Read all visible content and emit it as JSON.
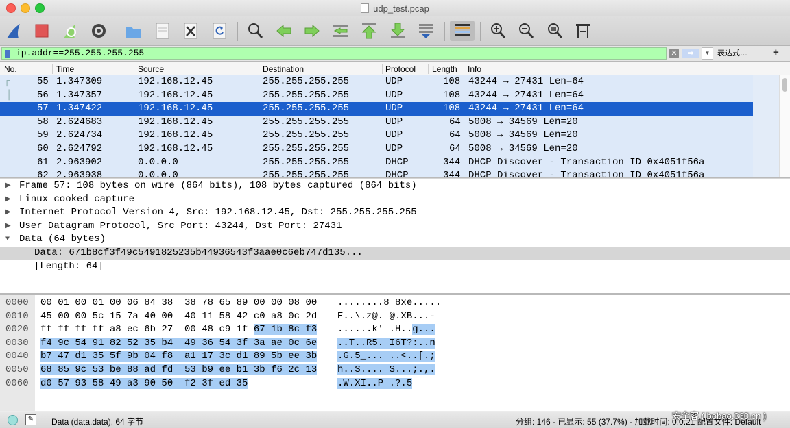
{
  "window": {
    "title": "udp_test.pcap"
  },
  "toolbar": {
    "icons": [
      "shark-fin-icon",
      "stop-icon",
      "restart-icon",
      "options-icon",
      "open-icon",
      "save-icon",
      "close-file-icon",
      "reload-icon",
      "find-icon",
      "back-icon",
      "forward-icon",
      "goto-icon",
      "first-icon",
      "last-icon",
      "autoscroll-icon",
      "colorize-icon",
      "zoom-in-icon",
      "zoom-out-icon",
      "zoom-normal-icon",
      "resize-columns-icon"
    ]
  },
  "filter": {
    "value": "ip.addr==255.255.255.255",
    "clear": "✕",
    "apply": "➡",
    "expression": "表达式…",
    "add": "+"
  },
  "columns": [
    "No.",
    "Time",
    "Source",
    "Destination",
    "Protocol",
    "Length",
    "Info"
  ],
  "packets": [
    {
      "no": "55",
      "time": "1.347309",
      "src": "192.168.12.45",
      "dst": "255.255.255.255",
      "proto": "UDP",
      "len": "108",
      "info": "43244 → 27431 Len=64"
    },
    {
      "no": "56",
      "time": "1.347357",
      "src": "192.168.12.45",
      "dst": "255.255.255.255",
      "proto": "UDP",
      "len": "108",
      "info": "43244 → 27431 Len=64"
    },
    {
      "no": "57",
      "time": "1.347422",
      "src": "192.168.12.45",
      "dst": "255.255.255.255",
      "proto": "UDP",
      "len": "108",
      "info": "43244 → 27431 Len=64"
    },
    {
      "no": "58",
      "time": "2.624683",
      "src": "192.168.12.45",
      "dst": "255.255.255.255",
      "proto": "UDP",
      "len": "64",
      "info": "5008 → 34569 Len=20"
    },
    {
      "no": "59",
      "time": "2.624734",
      "src": "192.168.12.45",
      "dst": "255.255.255.255",
      "proto": "UDP",
      "len": "64",
      "info": "5008 → 34569 Len=20"
    },
    {
      "no": "60",
      "time": "2.624792",
      "src": "192.168.12.45",
      "dst": "255.255.255.255",
      "proto": "UDP",
      "len": "64",
      "info": "5008 → 34569 Len=20"
    },
    {
      "no": "61",
      "time": "2.963902",
      "src": "0.0.0.0",
      "dst": "255.255.255.255",
      "proto": "DHCP",
      "len": "344",
      "info": "DHCP Discover - Transaction ID 0x4051f56a"
    },
    {
      "no": "62",
      "time": "2.963938",
      "src": "0.0.0.0",
      "dst": "255.255.255.255",
      "proto": "DHCP",
      "len": "344",
      "info": "DHCP Discover - Transaction ID 0x4051f56a"
    }
  ],
  "details": [
    {
      "marker": "▶",
      "text": "Frame 57: 108 bytes on wire (864 bits), 108 bytes captured (864 bits)"
    },
    {
      "marker": "▶",
      "text": "Linux cooked capture"
    },
    {
      "marker": "▶",
      "text": "Internet Protocol Version 4, Src: 192.168.12.45, Dst: 255.255.255.255"
    },
    {
      "marker": "▶",
      "text": "User Datagram Protocol, Src Port: 43244, Dst Port: 27431"
    },
    {
      "marker": "▼",
      "text": "Data (64 bytes)"
    },
    {
      "marker": "",
      "text": "Data: 671b8cf3f49c5491825235b44936543f3aae0c6eb747d135..."
    },
    {
      "marker": "",
      "text": "[Length: 64]"
    }
  ],
  "bytes": [
    {
      "off": "0000",
      "hex_a": "00 01 00 01 00 06 84 38  38 78 65 89 00 00 08 00",
      "hex_b": "",
      "asc_a": "........8 8xe.....",
      "asc_b": ""
    },
    {
      "off": "0010",
      "hex_a": "45 00 00 5c 15 7a 40 00  40 11 58 42 c0 a8 0c 2d",
      "hex_b": "",
      "asc_a": "E..\\.z@. @.XB...-",
      "asc_b": ""
    },
    {
      "off": "0020",
      "hex_a": "ff ff ff ff a8 ec 6b 27  00 48 c9 1f ",
      "hex_b": "67 1b 8c f3",
      "asc_a": "......k' .H..",
      "asc_b": "g..."
    },
    {
      "off": "0030",
      "hex_a": "",
      "hex_b": "f4 9c 54 91 82 52 35 b4  49 36 54 3f 3a ae 0c 6e",
      "asc_a": "",
      "asc_b": "..T..R5. I6T?:..n"
    },
    {
      "off": "0040",
      "hex_a": "",
      "hex_b": "b7 47 d1 35 5f 9b 04 f8  a1 17 3c d1 89 5b ee 3b",
      "asc_a": "",
      "asc_b": ".G.5_... ..<..[.;"
    },
    {
      "off": "0050",
      "hex_a": "",
      "hex_b": "68 85 9c 53 be 88 ad fd  53 b9 ee b1 3b f6 2c 13",
      "asc_a": "",
      "asc_b": "h..S.... S...;.,."
    },
    {
      "off": "0060",
      "hex_a": "",
      "hex_b": "d0 57 93 58 49 a3 90 50  f2 3f ed 35",
      "asc_a": "",
      "asc_b": ".W.XI..P .?.5"
    }
  ],
  "status": {
    "left": "Data (data.data), 64 字节",
    "right": "分组: 146 · 已显示: 55 (37.7%) · 加载时间: 0:0.21    配置文件: Default"
  },
  "watermark": "安全客 ( bobao.360.cn )",
  "colors": {
    "selected_row": "#1b5fcd",
    "udp_row": "#dde9f9",
    "filter_ok": "#afffaf",
    "byte_highlight": "#a7cdf5"
  }
}
